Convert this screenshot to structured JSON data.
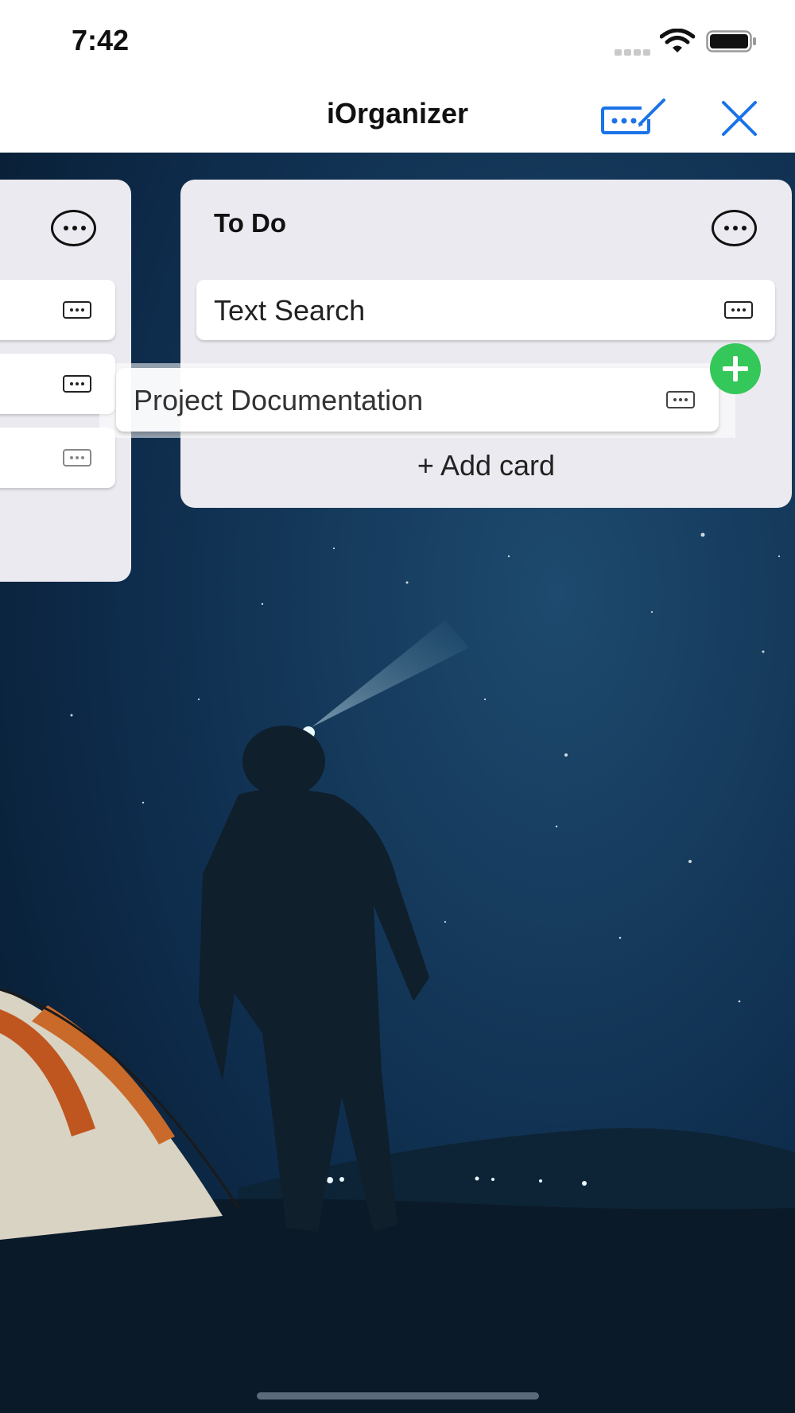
{
  "status_bar": {
    "time": "7:42"
  },
  "nav": {
    "title": "iOrganizer"
  },
  "lists": {
    "left": {
      "cards": [
        "",
        "",
        ""
      ]
    },
    "todo": {
      "title": "To Do",
      "cards": [
        "Text Search"
      ],
      "add_card_label": "+ Add card"
    }
  },
  "dragged_card": {
    "title": "Project Documentation"
  },
  "colors": {
    "accent": "#1a73e8",
    "add_badge": "#34c759",
    "list_background": "#ebeaf0",
    "night_sky": "#0c2540"
  }
}
